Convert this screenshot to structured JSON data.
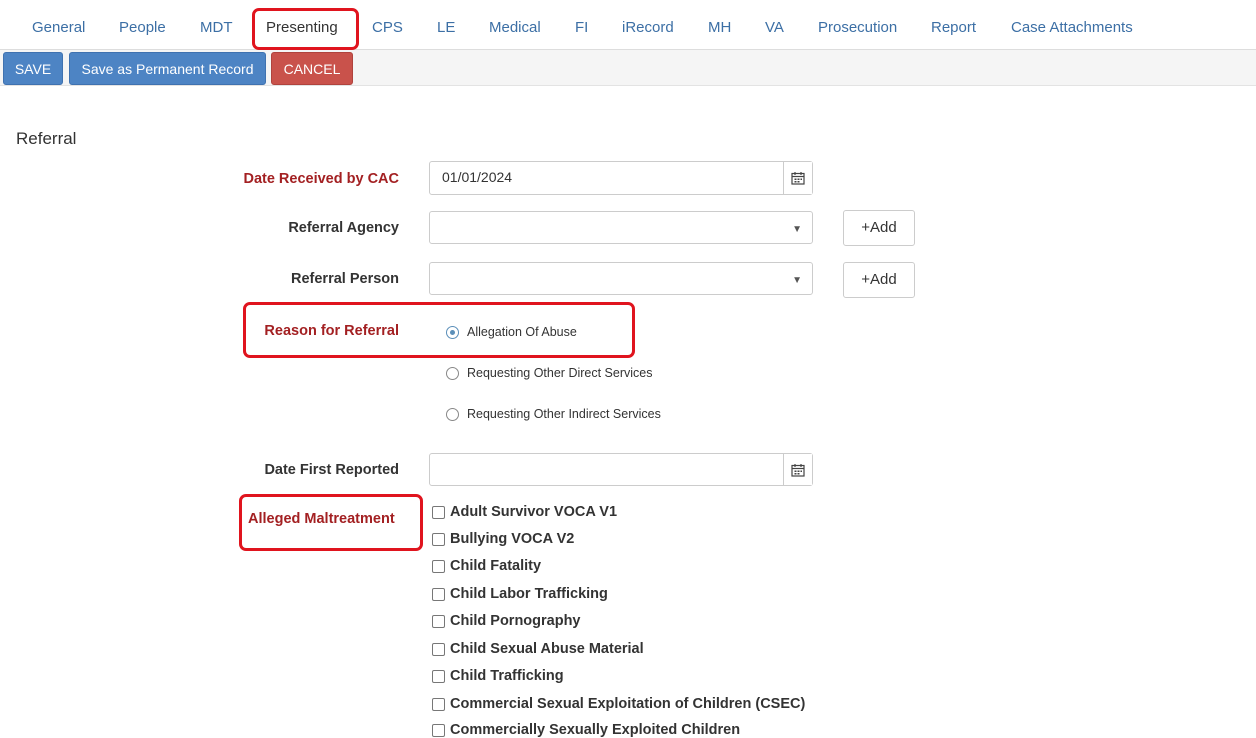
{
  "tabs": [
    {
      "label": "General"
    },
    {
      "label": "People"
    },
    {
      "label": "MDT"
    },
    {
      "label": "Presenting"
    },
    {
      "label": "CPS"
    },
    {
      "label": "LE"
    },
    {
      "label": "Medical"
    },
    {
      "label": "FI"
    },
    {
      "label": "iRecord"
    },
    {
      "label": "MH"
    },
    {
      "label": "VA"
    },
    {
      "label": "Prosecution"
    },
    {
      "label": "Report"
    },
    {
      "label": "Case Attachments"
    }
  ],
  "active_tab": "Presenting",
  "toolbar": {
    "save_label": "SAVE",
    "permanent_label": "Save as Permanent Record",
    "cancel_label": "CANCEL"
  },
  "section": {
    "title": "Referral"
  },
  "fields": {
    "date_received": {
      "label": "Date Received by CAC",
      "value": "01/01/2024",
      "required": true
    },
    "referral_agency": {
      "label": "Referral Agency",
      "value": "",
      "add_label": "+Add"
    },
    "referral_person": {
      "label": "Referral Person",
      "value": "",
      "add_label": "+Add"
    },
    "reason": {
      "label": "Reason for Referral",
      "required": true,
      "options": [
        {
          "label": "Allegation Of Abuse",
          "checked": true
        },
        {
          "label": "Requesting Other Direct Services",
          "checked": false
        },
        {
          "label": "Requesting Other Indirect Services",
          "checked": false
        }
      ]
    },
    "date_first_reported": {
      "label": "Date First Reported",
      "value": ""
    },
    "alleged_maltreatment": {
      "label": "Alleged Maltreatment",
      "required": true,
      "options": [
        "Adult Survivor VOCA V1",
        "Bullying VOCA V2",
        "Child Fatality",
        "Child Labor Trafficking",
        "Child Pornography",
        "Child Sexual Abuse Material",
        "Child Trafficking",
        "Commercial Sexual Exploitation of Children (CSEC)",
        "Commercially Sexually Exploited Children"
      ]
    }
  },
  "icons": {
    "calendar": "calendar-icon",
    "dropdown": "chevron-down-icon",
    "plus": "plus-icon"
  },
  "colors": {
    "link": "#3c6fa5",
    "required_label": "#a32022",
    "primary": "#4d84c4",
    "danger": "#c9524b",
    "highlight": "#e0141e"
  }
}
